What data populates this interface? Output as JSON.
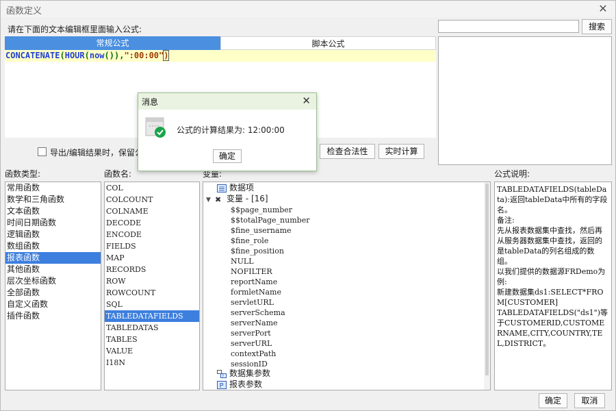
{
  "window": {
    "title": "函数定义"
  },
  "prompt_label": "请在下面的文本编辑框里面输入公式:",
  "search": {
    "value": "",
    "button": "搜索"
  },
  "tabs": [
    {
      "label": "常规公式",
      "active": true
    },
    {
      "label": "脚本公式",
      "active": false
    }
  ],
  "formula": {
    "func1": "CONCATENATE",
    "open1": "(",
    "func2": "HOUR",
    "open2": "(",
    "func3": "now",
    "rest": "()),",
    "str": "\":00:00\"",
    "close": ")"
  },
  "export_option": "导出/编辑结果时，保留公",
  "buttons": {
    "check": "检查合法性",
    "realtime": "实时计算",
    "ok": "确定",
    "cancel": "取消"
  },
  "headers": {
    "func_type": "函数类型:",
    "func_name": "函数名:",
    "variables": "变量:",
    "description": "公式说明:"
  },
  "func_types": [
    "常用函数",
    "数学和三角函数",
    "文本函数",
    "时间日期函数",
    "逻辑函数",
    "数组函数",
    "报表函数",
    "其他函数",
    "层次坐标函数",
    "全部函数",
    "自定义函数",
    "插件函数"
  ],
  "func_types_selected": 6,
  "func_names": [
    "COL",
    "COLCOUNT",
    "COLNAME",
    "DECODE",
    "ENCODE",
    "FIELDS",
    "MAP",
    "RECORDS",
    "ROW",
    "ROWCOUNT",
    "SQL",
    "TABLEDATAFIELDS",
    "TABLEDATAS",
    "TABLES",
    "VALUE",
    "I18N"
  ],
  "func_names_selected": 11,
  "variables": {
    "data_items": "数据项",
    "var_group": "变量 - [16]",
    "vars": [
      "$$page_number",
      "$$totalPage_number",
      "$fine_username",
      "$fine_role",
      "$fine_position",
      "NULL",
      "NOFILTER",
      "reportName",
      "formletName",
      "servletURL",
      "serverSchema",
      "serverName",
      "serverPort",
      "serverURL",
      "contextPath",
      "sessionID"
    ],
    "dataset_params": "数据集参数",
    "report_params": "报表参数"
  },
  "description": [
    "TABLEDATAFIELDS(tableData):返回tableData中所有的字段名。",
    "备注:",
    "先从报表数据集中查找，然后再从服务器数据集中查找，返回的是tableData的列名组成的数组。",
    "以我们提供的数据源FRDemo为例:",
    "新建数据集ds1:SELECT*FROM[CUSTOMER]",
    "TABLEDATAFIELDS(\"ds1\")等于CUSTOMERID,CUSTOMERNAME,CITY,COUNTRY,TEL,DISTRICT。"
  ],
  "message_dialog": {
    "title": "消息",
    "text": "公式的计算结果为: 12:00:00",
    "ok": "确定"
  },
  "colors": {
    "accent": "#4a8fe0",
    "selection": "#3d7fde",
    "formula_bg": "#ffffc8",
    "dialog_title_bg": "#eaf3e2"
  }
}
